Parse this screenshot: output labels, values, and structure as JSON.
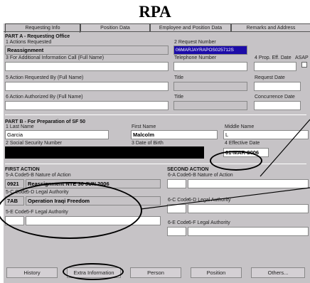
{
  "title": "RPA",
  "tabs": [
    "Requesting Info",
    "Position Data",
    "Employee and Position Data",
    "Remarks and Address"
  ],
  "part_a": {
    "heading": "PART A - Requesting Office",
    "actions_requested_label": "1 Actions Requested",
    "actions_requested_value": "Reassignment",
    "request_number_label": "2 Request Number",
    "request_number_value": "06MARJAYRAPOS025712S",
    "additional_info_label": "3 For Additional Information Call (Full Name)",
    "telephone_label": "Telephone Number",
    "prop_eff_date_label": "4 Prop. Eff. Date",
    "asap_label": "ASAP",
    "action_requested_by_label": "5 Action Requested By (Full Name)",
    "title_label_1": "Title",
    "request_date_label": "Request Date",
    "action_authorized_by_label": "6 Action Authorized By (Full Name)",
    "title_label_2": "Title",
    "concurrence_date_label": "Concurrence Date"
  },
  "part_b": {
    "heading": "PART B - For Preparation of SF 50",
    "last_name_label": "1 Last Name",
    "last_name_value": "Garcia",
    "first_name_label": "First Name",
    "first_name_value": "Malcolm",
    "middle_name_label": "Middle Name",
    "middle_name_value": "L",
    "ssn_label": "2 Social Security Number",
    "dob_label": "3 Date of Birth",
    "effective_date_label": "4 Effective Date",
    "effective_date_value": "01-MAR-2006"
  },
  "first_action": {
    "heading": "FIRST ACTION",
    "noa_code_label": "5-A Code",
    "noa_label": "5-B Nature of Action",
    "noa_code_value": "0921",
    "noa_value": "Reassignment NTE 30 JUN 2006",
    "legal_code_label": "5-C Code",
    "legal_label": "5-D Legal Authority",
    "legal_code_value": "7AB",
    "legal_value": "Operation Iraqi Freedom",
    "e_code_label": "5-E Code",
    "f_label": "5-F Legal Authority"
  },
  "second_action": {
    "heading": "SECOND ACTION",
    "noa_code_label": "6-A Code",
    "noa_label": "6-B Nature of Action",
    "legal_code_label": "6-C Code",
    "legal_label": "6-D Legal Authority",
    "e_code_label": "6-E Code",
    "f_label": "6-F Legal Authority"
  },
  "buttons": [
    "History",
    "Extra Information",
    "Person",
    "Position",
    "Others..."
  ]
}
